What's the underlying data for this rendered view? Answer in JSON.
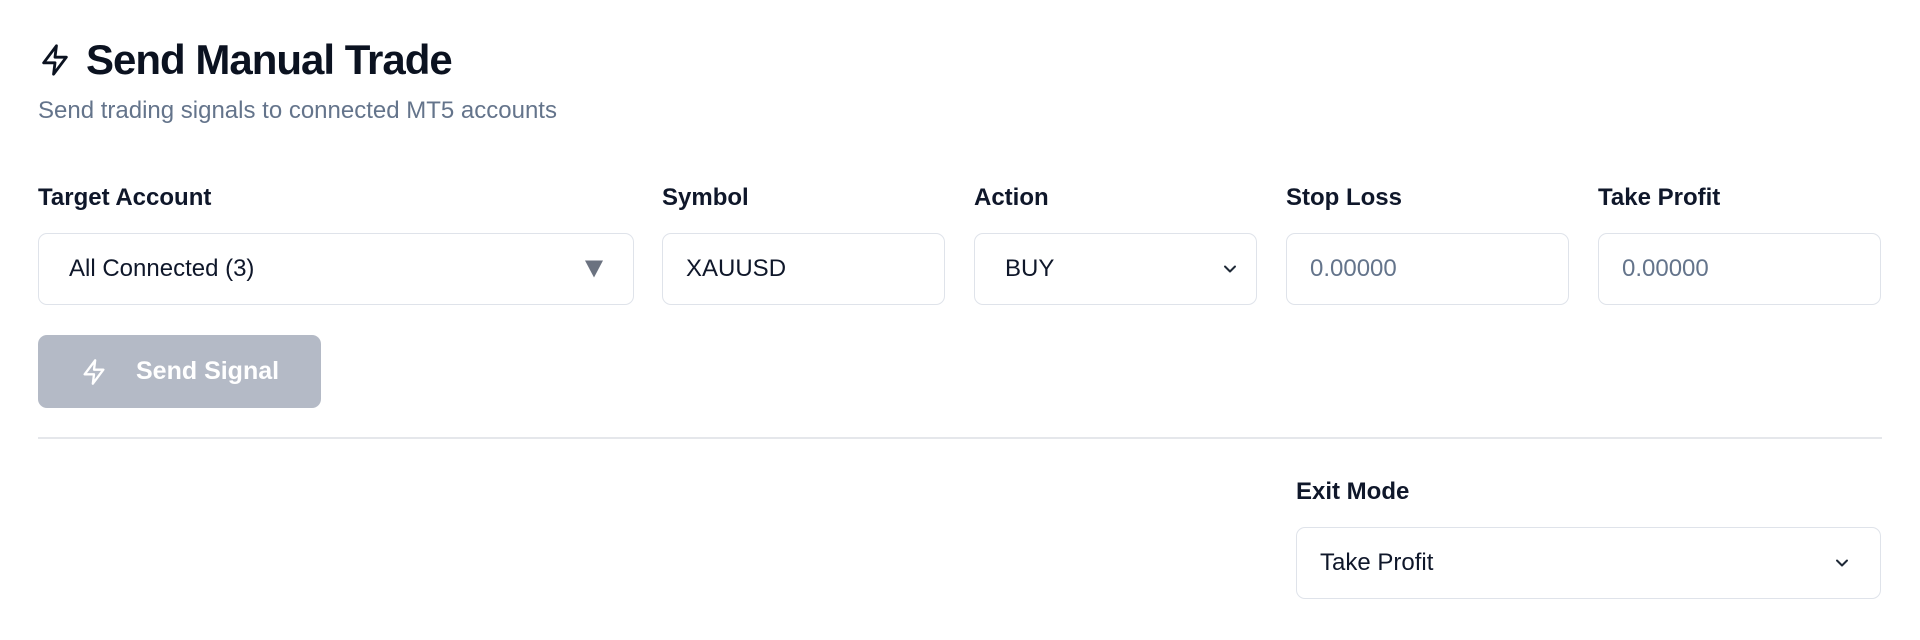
{
  "header": {
    "title": "Send Manual Trade",
    "subtitle": "Send trading signals to connected MT5 accounts",
    "icon": "lightning-icon"
  },
  "form": {
    "target_account": {
      "label": "Target Account",
      "value": "All Connected (3)"
    },
    "symbol": {
      "label": "Symbol",
      "value": "XAUUSD"
    },
    "action": {
      "label": "Action",
      "value": "BUY"
    },
    "stop_loss": {
      "label": "Stop Loss",
      "placeholder": "0.00000"
    },
    "take_profit": {
      "label": "Take Profit",
      "placeholder": "0.00000"
    },
    "send_button": {
      "label": "Send Signal",
      "icon": "lightning-icon",
      "disabled": true
    },
    "exit_mode": {
      "label": "Exit Mode",
      "value": "Take Profit"
    }
  },
  "colors": {
    "button_disabled_bg": "#b4bac6",
    "border": "#dfe3ea",
    "muted_text": "#64748b"
  }
}
